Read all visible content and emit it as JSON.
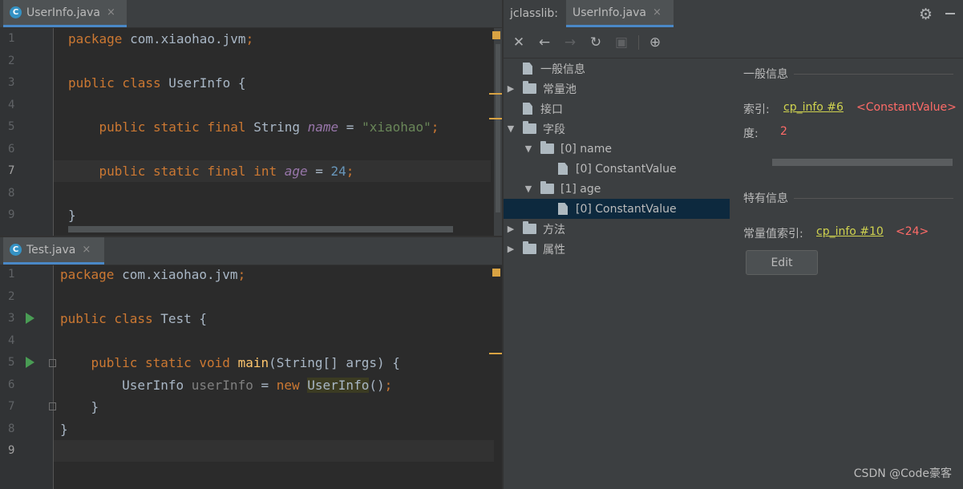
{
  "top_editor": {
    "tab": {
      "icon_letter": "C",
      "label": "UserInfo.java",
      "close": "×"
    },
    "lines": [
      {
        "n": "1",
        "tokens": [
          [
            "kw",
            "package "
          ],
          [
            "plain",
            "com.xiaohao.jvm"
          ],
          [
            "kw",
            ";"
          ]
        ]
      },
      {
        "n": "2",
        "tokens": []
      },
      {
        "n": "3",
        "tokens": [
          [
            "kw",
            "public class "
          ],
          [
            "plain",
            "UserInfo {"
          ]
        ]
      },
      {
        "n": "4",
        "tokens": []
      },
      {
        "n": "5",
        "tokens": [
          [
            "plain",
            "    "
          ],
          [
            "kw",
            "public static final "
          ],
          [
            "plain",
            "String "
          ],
          [
            "ital",
            "name"
          ],
          [
            "plain",
            " = "
          ],
          [
            "str",
            "\"xiaohao\""
          ],
          [
            "kw",
            ";"
          ]
        ]
      },
      {
        "n": "6",
        "tokens": []
      },
      {
        "n": "7",
        "tokens": [
          [
            "plain",
            "    "
          ],
          [
            "kw",
            "public static final int "
          ],
          [
            "ital",
            "age"
          ],
          [
            "plain",
            " = "
          ],
          [
            "num",
            "24"
          ],
          [
            "kw",
            ";"
          ]
        ]
      },
      {
        "n": "8",
        "tokens": []
      },
      {
        "n": "9",
        "tokens": [
          [
            "plain",
            "}"
          ]
        ]
      }
    ]
  },
  "bottom_editor": {
    "tab": {
      "icon_letter": "C",
      "label": "Test.java",
      "close": "×"
    },
    "lines": [
      {
        "n": "1",
        "tokens": [
          [
            "kw",
            "package "
          ],
          [
            "plain",
            "com.xiaohao.jvm"
          ],
          [
            "kw",
            ";"
          ]
        ]
      },
      {
        "n": "2",
        "tokens": []
      },
      {
        "n": "3",
        "tokens": [
          [
            "kw",
            "public class "
          ],
          [
            "plain",
            "Test {"
          ]
        ]
      },
      {
        "n": "4",
        "tokens": []
      },
      {
        "n": "5",
        "tokens": [
          [
            "plain",
            "    "
          ],
          [
            "kw",
            "public static void "
          ],
          [
            "fn",
            "main"
          ],
          [
            "plain",
            "(String[] args) {"
          ]
        ]
      },
      {
        "n": "6",
        "tokens": [
          [
            "plain",
            "        UserInfo "
          ],
          [
            "unused",
            "userInfo"
          ],
          [
            "plain",
            " = "
          ],
          [
            "kw",
            "new "
          ],
          [
            "hlname",
            "UserInfo"
          ],
          [
            "plain",
            "()"
          ],
          [
            "kw",
            ";"
          ]
        ]
      },
      {
        "n": "7",
        "tokens": [
          [
            "plain",
            "    }"
          ]
        ]
      },
      {
        "n": "8",
        "tokens": [
          [
            "plain",
            "}"
          ]
        ]
      },
      {
        "n": "9",
        "tokens": []
      }
    ]
  },
  "jclasslib": {
    "title": "jclasslib:",
    "tab": {
      "label": "UserInfo.java",
      "close": "×"
    },
    "settings_icon": "gear-icon",
    "toolbar": [
      {
        "name": "close-icon",
        "glyph": "✕",
        "enabled": true
      },
      {
        "name": "back-arrow-icon",
        "glyph": "←",
        "enabled": true
      },
      {
        "name": "forward-arrow-icon",
        "glyph": "→",
        "enabled": false
      },
      {
        "name": "refresh-icon",
        "glyph": "↻",
        "enabled": true
      },
      {
        "name": "save-icon",
        "glyph": "▣",
        "enabled": false
      },
      {
        "name": "globe-icon",
        "glyph": "⊕",
        "enabled": true
      }
    ],
    "tree": [
      {
        "label": "一般信息",
        "indent": 0,
        "arrow": "",
        "icon": "file"
      },
      {
        "label": "常量池",
        "indent": 0,
        "arrow": "▶",
        "icon": "folder"
      },
      {
        "label": "接口",
        "indent": 0,
        "arrow": "",
        "icon": "file"
      },
      {
        "label": "字段",
        "indent": 0,
        "arrow": "▼",
        "icon": "folder"
      },
      {
        "label": "[0] name",
        "indent": 1,
        "arrow": "▼",
        "icon": "folder"
      },
      {
        "label": "[0] ConstantValue",
        "indent": 2,
        "arrow": "",
        "icon": "file"
      },
      {
        "label": "[1] age",
        "indent": 1,
        "arrow": "▼",
        "icon": "folder"
      },
      {
        "label": "[0] ConstantValue",
        "indent": 2,
        "arrow": "",
        "icon": "file",
        "selected": true
      },
      {
        "label": "方法",
        "indent": 0,
        "arrow": "▶",
        "icon": "folder"
      },
      {
        "label": "属性",
        "indent": 0,
        "arrow": "▶",
        "icon": "folder"
      }
    ],
    "detail": {
      "general_title": "一般信息",
      "name_index_label": "索引:",
      "name_index_link": "cp_info #6",
      "name_index_value": "<ConstantValue>",
      "length_label": "度:",
      "length_value": "2",
      "specific_title": "特有信息",
      "cv_index_label": "常量值索引:",
      "cv_index_link": "cp_info #10",
      "cv_index_value": "<24>",
      "edit_button": "Edit"
    }
  },
  "watermark": "CSDN @Code豪客"
}
